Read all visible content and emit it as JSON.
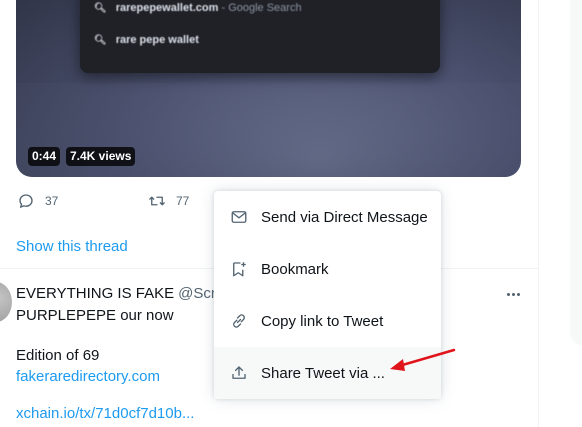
{
  "video": {
    "suggestions": [
      {
        "text": "rarepepewallet.com",
        "suffix": " - Google Search"
      },
      {
        "text": "rare pepe wallet",
        "suffix": ""
      }
    ],
    "duration": "0:44",
    "views": "7.4K views"
  },
  "actions": {
    "reply_count": "37",
    "retweet_count": "77"
  },
  "show_thread": "Show this thread",
  "tweet2": {
    "author_name": "EVERYTHING IS FAKE",
    "handle": "@Scri",
    "line1": "PURPLEPEPE our now",
    "line2": "Edition of 69",
    "link1": "fakeraredirectory.com",
    "link2": "xchain.io/tx/71d0cf7d10b..."
  },
  "menu": {
    "items": [
      {
        "label": "Send via Direct Message",
        "icon": "envelope-icon"
      },
      {
        "label": "Bookmark",
        "icon": "bookmark-add-icon"
      },
      {
        "label": "Copy link to Tweet",
        "icon": "link-icon"
      },
      {
        "label": "Share Tweet via ...",
        "icon": "share-icon"
      }
    ],
    "highlighted_index": 3
  },
  "colors": {
    "accent": "#1d9bf0",
    "secondary_text": "#536471",
    "annotation_arrow": "#e0151b"
  }
}
